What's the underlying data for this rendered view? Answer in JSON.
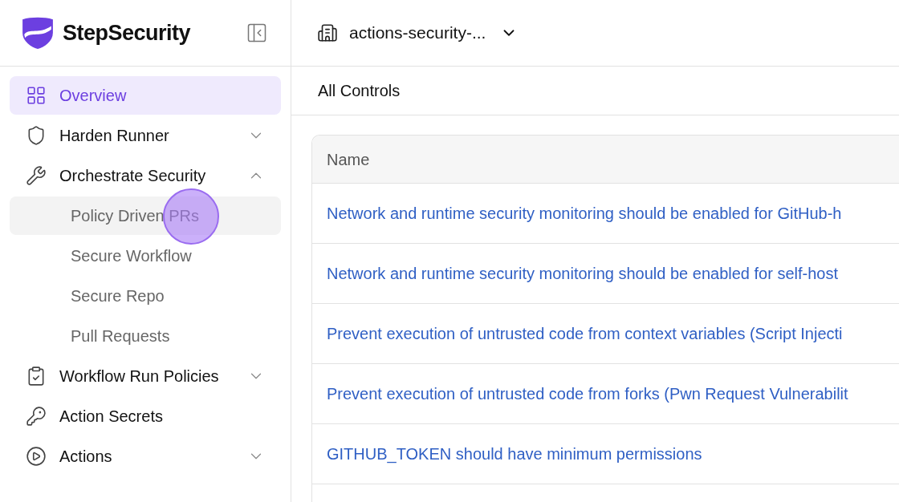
{
  "brand": {
    "name": "StepSecurity"
  },
  "org_selector": {
    "label": "actions-security-..."
  },
  "nav": [
    {
      "kind": "item",
      "label": "Overview",
      "selected": true
    },
    {
      "kind": "group",
      "label": "Harden Runner",
      "selected": false,
      "expanded": false
    },
    {
      "kind": "group",
      "label": "Orchestrate Security",
      "selected": false,
      "expanded": true,
      "children": [
        {
          "label": "Policy Driven PRs",
          "selected": false,
          "hovered": true,
          "pointer": true
        },
        {
          "label": "Secure Workflow",
          "selected": false,
          "hovered": false,
          "pointer": false
        },
        {
          "label": "Secure Repo",
          "selected": false,
          "hovered": false,
          "pointer": false
        },
        {
          "label": "Pull Requests",
          "selected": false,
          "hovered": false,
          "pointer": false
        }
      ]
    },
    {
      "kind": "group",
      "label": "Workflow Run Policies",
      "selected": false,
      "expanded": false
    },
    {
      "kind": "item",
      "label": "Action Secrets",
      "selected": false
    },
    {
      "kind": "group",
      "label": "Actions",
      "selected": false,
      "expanded": false
    }
  ],
  "page_title": "All Controls",
  "table": {
    "columns": [
      "Name"
    ],
    "rows": [
      "Network and runtime security monitoring should be enabled for GitHub-h",
      "Network and runtime security monitoring should be enabled for self-host",
      "Prevent execution of untrusted code from context variables (Script Injecti",
      "Prevent execution of untrusted code from forks (Pwn Request Vulnerabilit",
      "GITHUB_TOKEN should have minimum permissions"
    ]
  }
}
